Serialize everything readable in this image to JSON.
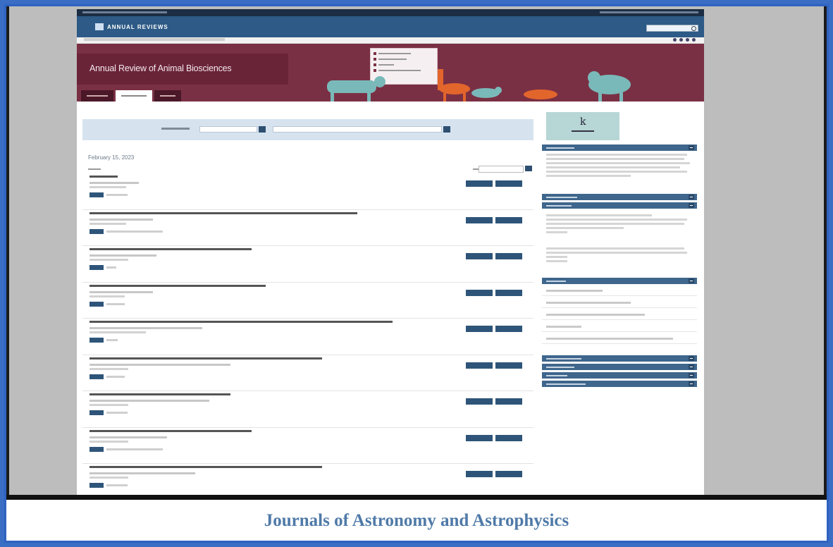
{
  "header": {
    "logo_text": "ANNUAL REVIEWS"
  },
  "banner": {
    "journal_title": "Annual Review of Animal Biosciences"
  },
  "main": {
    "date": "February 15, 2023"
  },
  "caption": "Journals of Astronomy and Astrophysics",
  "colors": {
    "frame": "#2f63c0",
    "header": "#2d5a86",
    "banner": "#7a3044",
    "animals": "#7ab9b9",
    "accent_animal": "#e2652c",
    "buttons": "#2e5579",
    "caption": "#4f7aa8"
  }
}
